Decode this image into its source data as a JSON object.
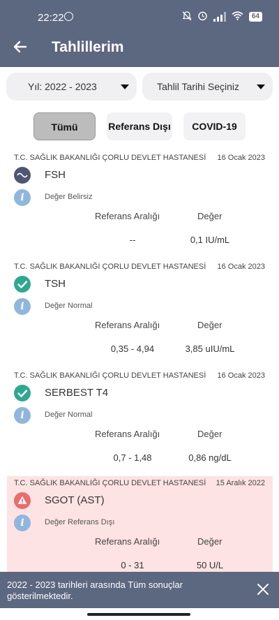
{
  "status_bar": {
    "time": "22:22",
    "battery": "64",
    "icons": [
      "whatsapp-icon",
      "bell-off-icon",
      "alarm-icon",
      "signal-icon",
      "wifi-icon",
      "battery-icon"
    ]
  },
  "app_bar": {
    "title": "Tahlillerim"
  },
  "filters": {
    "year": "Yıl: 2022 - 2023",
    "date": "Tahlil Tarihi Seçiniz"
  },
  "tabs": [
    {
      "label": "Tümü",
      "active": true
    },
    {
      "label": "Referans Dışı",
      "active": false
    },
    {
      "label": "COVID-19",
      "active": false
    }
  ],
  "results": [
    {
      "hospital": "T.C. SAĞLIK BAKANLIĞI ÇORLU DEVLET HASTANESİ",
      "date": "16 Ocak 2023",
      "test": "FSH",
      "status": "uncertain",
      "note": "Değer Belirsiz",
      "ref_header": "Referans Aralığı",
      "val_header": "Değer",
      "range": "--",
      "value": "0,1 IU/mL"
    },
    {
      "hospital": "T.C. SAĞLIK BAKANLIĞI ÇORLU DEVLET HASTANESİ",
      "date": "16 Ocak 2023",
      "test": "TSH",
      "status": "normal",
      "note": "Değer Normal",
      "ref_header": "Referans Aralığı",
      "val_header": "Değer",
      "range": "0,35 - 4,94",
      "value": "3,85 uIU/mL"
    },
    {
      "hospital": "T.C. SAĞLIK BAKANLIĞI ÇORLU DEVLET HASTANESİ",
      "date": "16 Ocak 2023",
      "test": "SERBEST T4",
      "status": "normal",
      "note": "Değer Normal",
      "ref_header": "Referans Aralığı",
      "val_header": "Değer",
      "range": "0,7 - 1,48",
      "value": "0,86 ng/dL"
    },
    {
      "hospital": "T.C. SAĞLIK BAKANLIĞI ÇORLU DEVLET HASTANESİ",
      "date": "15 Aralık 2022",
      "test": "SGOT (AST)",
      "status": "out_of_range",
      "note": "Değer Referans Dışı",
      "ref_header": "Referans Aralığı",
      "val_header": "Değer",
      "range": "0 - 31",
      "value": "50 U/L"
    }
  ],
  "snackbar": {
    "message": "2022 - 2023 tarihleri arasında Tüm sonuçlar gösterilmektedir."
  },
  "colors": {
    "primary": "#5c6780",
    "normal": "#2fa890",
    "warning": "#ec6b6b",
    "info": "#8fb7de",
    "alert_bg": "#fde3e3"
  }
}
